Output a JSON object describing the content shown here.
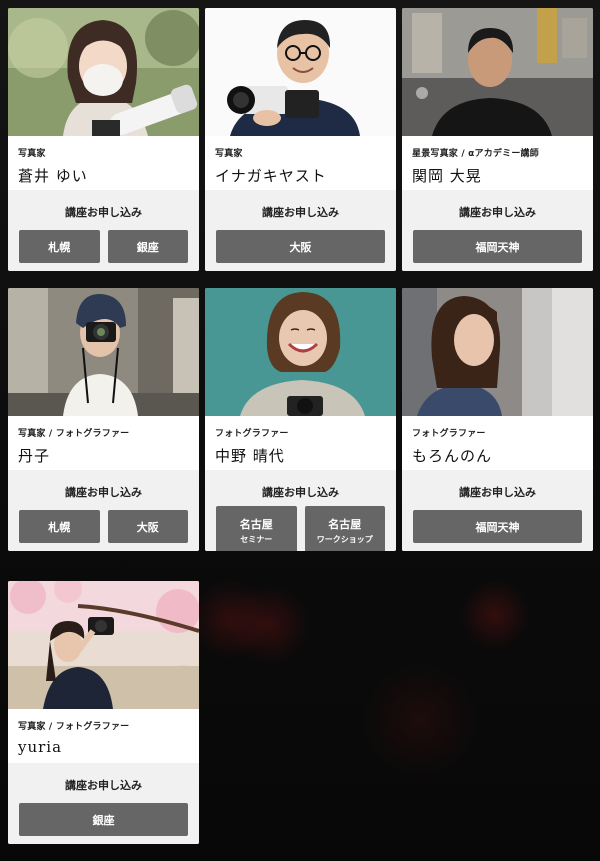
{
  "apply_label": "講座お申し込み",
  "cards": [
    {
      "role": "写真家",
      "name": "蒼井 ゆい",
      "buttons": [
        {
          "label": "札幌"
        },
        {
          "label": "銀座"
        }
      ]
    },
    {
      "role": "写真家",
      "name": "イナガキヤスト",
      "buttons": [
        {
          "label": "大阪"
        }
      ]
    },
    {
      "role": "星景写真家 / αアカデミー講師",
      "name": "関岡 大晃",
      "buttons": [
        {
          "label": "福岡天神"
        }
      ]
    },
    {
      "role": "写真家 / フォトグラファー",
      "name": "丹子",
      "buttons": [
        {
          "label": "札幌"
        },
        {
          "label": "大阪"
        }
      ]
    },
    {
      "role": "フォトグラファー",
      "name": "中野 晴代",
      "buttons": [
        {
          "label": "名古屋",
          "sub": "セミナー"
        },
        {
          "label": "名古屋",
          "sub": "ワークショップ"
        }
      ]
    },
    {
      "role": "フォトグラファー",
      "name": "もろんのん",
      "buttons": [
        {
          "label": "福岡天神"
        }
      ]
    },
    {
      "role": "写真家 / フォトグラファー",
      "name": "yuria",
      "buttons": [
        {
          "label": "銀座"
        }
      ]
    }
  ],
  "colors": {
    "button": "#666666",
    "apply_bg": "#f1f1f1",
    "page_bg": "#0d0d0d"
  }
}
